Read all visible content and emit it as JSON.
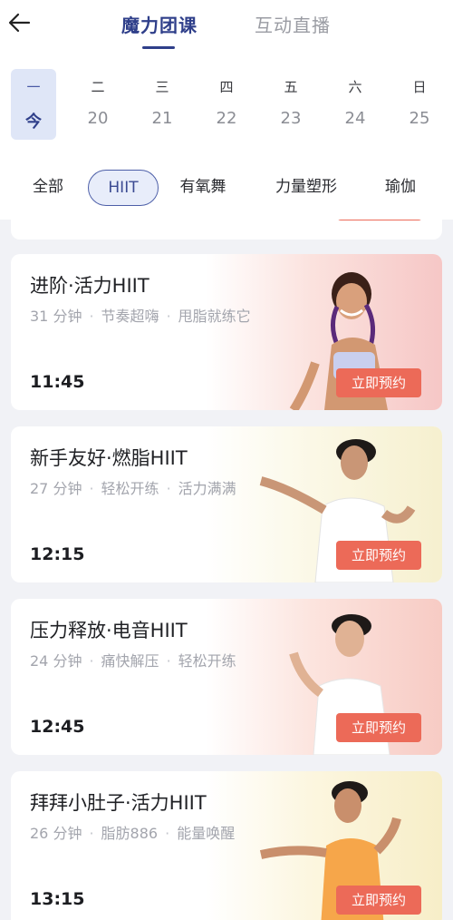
{
  "header": {
    "back_icon": "arrow-left-icon",
    "tabs": [
      {
        "label": "魔力团课",
        "active": true
      },
      {
        "label": "互动直播",
        "active": false
      }
    ]
  },
  "days": [
    {
      "weekday": "一",
      "date": "今",
      "selected": true
    },
    {
      "weekday": "二",
      "date": "20",
      "selected": false
    },
    {
      "weekday": "三",
      "date": "21",
      "selected": false
    },
    {
      "weekday": "四",
      "date": "22",
      "selected": false
    },
    {
      "weekday": "五",
      "date": "23",
      "selected": false
    },
    {
      "weekday": "六",
      "date": "24",
      "selected": false
    },
    {
      "weekday": "日",
      "date": "25",
      "selected": false
    }
  ],
  "filters": [
    {
      "label": "全部",
      "active": false
    },
    {
      "label": "HIIT",
      "active": true
    },
    {
      "label": "有氧舞",
      "active": false
    },
    {
      "label": "力量塑形",
      "active": false
    },
    {
      "label": "瑜伽",
      "active": false
    }
  ],
  "classes": [
    {
      "title": "进阶·活力HIIT",
      "duration": "31 分钟",
      "tag1": "节奏超嗨",
      "tag2": "甩脂就练它",
      "time": "11:45",
      "button": "立即预约",
      "bg_color": "#f9d3cf",
      "outfit_color": "#c9cfee"
    },
    {
      "title": "新手友好·燃脂HIIT",
      "duration": "27 分钟",
      "tag1": "轻松开练",
      "tag2": "活力满满",
      "time": "12:15",
      "button": "立即预约",
      "bg_color": "#f8f4d9",
      "outfit_color": "#ffffff"
    },
    {
      "title": "压力释放·电音HIIT",
      "duration": "24 分钟",
      "tag1": "痛快解压",
      "tag2": "轻松开练",
      "time": "12:45",
      "button": "立即预约",
      "bg_color": "#f9d7d0",
      "outfit_color": "#ffffff"
    },
    {
      "title": "拜拜小肚子·活力HIIT",
      "duration": "26 分钟",
      "tag1": "脂肪886",
      "tag2": "能量唤醒",
      "time": "13:15",
      "button": "立即预约",
      "bg_color": "#faf1cf",
      "outfit_color": "#f6a64a"
    }
  ]
}
